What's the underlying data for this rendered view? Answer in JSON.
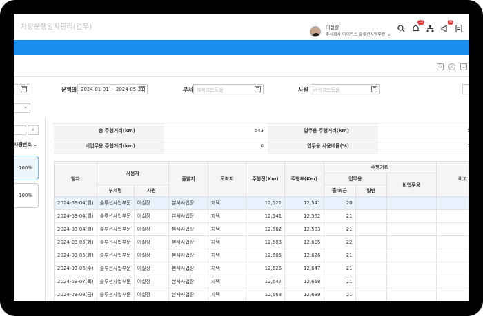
{
  "app": {
    "title": "차량운행일지관리(업무)",
    "user": {
      "name": "이실장",
      "org": "주식회사 아이런스 솔루션사업부문"
    },
    "notifications": {
      "bell": "13",
      "announce": "N"
    }
  },
  "colors": {
    "accent": "#1a8ff0",
    "highlight_row": "#e8f2fc"
  },
  "filters": {
    "period_label": "운행일",
    "period_value": "2024-01-01 ~ 2024-05-31",
    "dept_label": "부서",
    "dept_placeholder": "부서코드도움",
    "emp_label": "사원",
    "emp_placeholder": "사원코드도움"
  },
  "left_panel": {
    "header": "차량번호",
    "cards": [
      "100%",
      "100%"
    ]
  },
  "summary": {
    "total_label": "총 주행거리(km)",
    "total_value": "543",
    "business_label": "업무용 주행거리(km)",
    "business_value": "5",
    "nonbusiness_label": "비업무용 주행거리(km)",
    "nonbusiness_value": "0",
    "ratio_label": "업무용 사용비율(%)",
    "ratio_value": "1"
  },
  "table": {
    "headers": {
      "date": "일자",
      "user": "사용자",
      "dept": "부서명",
      "emp": "사원",
      "origin": "출발지",
      "dest": "도착지",
      "before": "주행전(Km)",
      "after": "주행후(Km)",
      "distance": "주행거리",
      "business": "업무용",
      "commute": "출/퇴근",
      "general": "일반",
      "nonbusiness": "비업무용",
      "note": "비고"
    },
    "rows": [
      {
        "date": "2024-03-04(월)",
        "dept": "솔루션사업부문",
        "emp": "이실장",
        "origin": "본사사업장",
        "dest": "자택",
        "before": "12,521",
        "after": "12,541",
        "commute": "20"
      },
      {
        "date": "2024-03-04(월)",
        "dept": "솔루션사업부문",
        "emp": "이실장",
        "origin": "본사사업장",
        "dest": "자택",
        "before": "12,541",
        "after": "12,562",
        "commute": "21"
      },
      {
        "date": "2024-03-04(월)",
        "dept": "솔루션사업부문",
        "emp": "이실장",
        "origin": "본사사업장",
        "dest": "자택",
        "before": "12,562",
        "after": "12,583",
        "commute": "21"
      },
      {
        "date": "2024-03-05(화)",
        "dept": "솔루션사업부문",
        "emp": "이실장",
        "origin": "본사사업장",
        "dest": "자택",
        "before": "12,583",
        "after": "12,605",
        "commute": "22"
      },
      {
        "date": "2024-03-05(화)",
        "dept": "솔루션사업부문",
        "emp": "이실장",
        "origin": "본사사업장",
        "dest": "자택",
        "before": "12,605",
        "after": "12,626",
        "commute": "21"
      },
      {
        "date": "2024-03-06(수)",
        "dept": "솔루션사업부문",
        "emp": "이실장",
        "origin": "본사사업장",
        "dest": "자택",
        "before": "12,626",
        "after": "12,647",
        "commute": "21"
      },
      {
        "date": "2024-03-07(목)",
        "dept": "솔루션사업부문",
        "emp": "이실장",
        "origin": "본사사업장",
        "dest": "자택",
        "before": "12,647",
        "after": "12,668",
        "commute": "21"
      },
      {
        "date": "2024-03-08(금)",
        "dept": "솔루션사업부문",
        "emp": "이실장",
        "origin": "본사사업장",
        "dest": "자택",
        "before": "12,668",
        "after": "12,689",
        "commute": "21"
      }
    ]
  }
}
